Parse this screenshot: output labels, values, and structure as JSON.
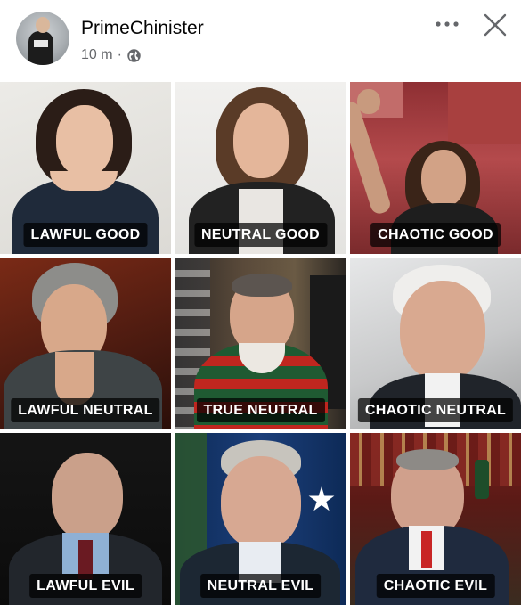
{
  "post": {
    "username": "PrimeChinister",
    "time": "10 m",
    "separator": "·"
  },
  "icons": {
    "avatar": "profile-photo",
    "audience": "globe-icon",
    "more": "more-options-icon",
    "close": "close-icon"
  },
  "grid": {
    "cells": [
      {
        "label": "LAWFUL GOOD"
      },
      {
        "label": "NEUTRAL GOOD"
      },
      {
        "label": "CHAOTIC GOOD"
      },
      {
        "label": "LAWFUL NEUTRAL"
      },
      {
        "label": "TRUE NEUTRAL"
      },
      {
        "label": "CHAOTIC  NEUTRAL"
      },
      {
        "label": "LAWFUL EVIL"
      },
      {
        "label": "NEUTRAL EVIL"
      },
      {
        "label": "CHAOTIC EVIL"
      }
    ]
  },
  "colors": {
    "username": "#050505",
    "meta": "#65676b",
    "label_bg": "#000000",
    "label_text": "#ffffff"
  }
}
